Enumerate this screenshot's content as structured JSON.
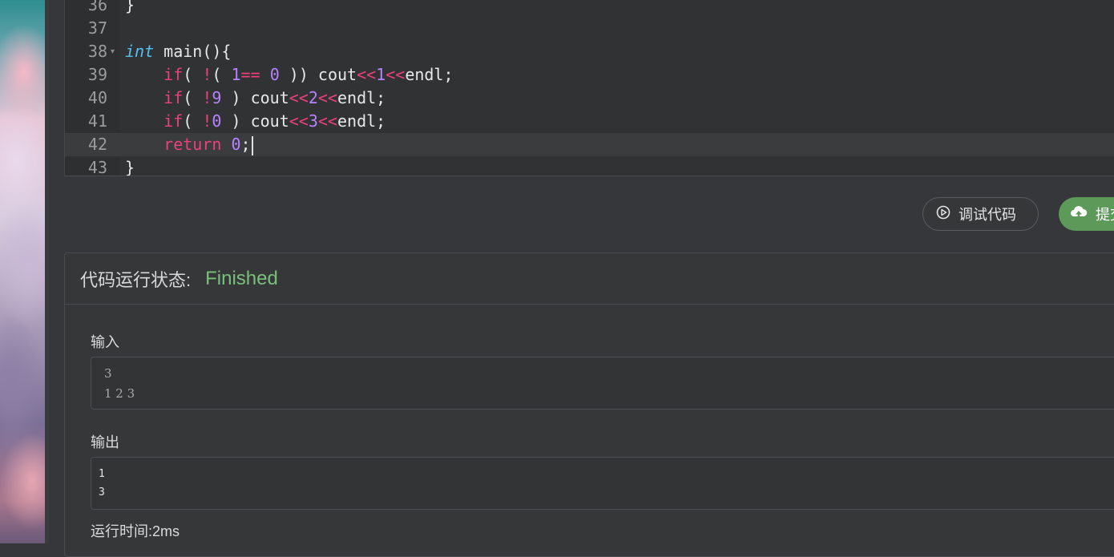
{
  "editor": {
    "lines": [
      {
        "n": "36"
      },
      {
        "n": "37"
      },
      {
        "n": "38"
      },
      {
        "n": "39"
      },
      {
        "n": "40"
      },
      {
        "n": "41"
      },
      {
        "n": "42"
      },
      {
        "n": "43"
      }
    ],
    "code": {
      "l36": "}",
      "l38_type": "int",
      "l38_rest": " main(){",
      "if_kw": "if",
      "cout": "cout",
      "endl": "endl;",
      "shift": "<<",
      "l39_a": "( ",
      "l39_not": "!",
      "l39_b": "( ",
      "l39_one": "1",
      "l39_eq": "==",
      "l39_zero": "0",
      "l39_c": " )) ",
      "l39_val": "1",
      "l40_a": "( ",
      "l40_not": "!",
      "l40_nine": "9",
      "l40_c": " ) ",
      "l40_val": "2",
      "l41_a": "( ",
      "l41_not": "!",
      "l41_zero": "0",
      "l41_c": " ) ",
      "l41_val": "3",
      "return_kw": "return",
      "return_val": "0",
      "semicolon": ";",
      "l43": "}"
    }
  },
  "actions": {
    "debug_label": "调试代码",
    "submit_label": "提交"
  },
  "status": {
    "label": "代码运行状态:",
    "value": "Finished",
    "value_color": "#79c07a"
  },
  "input": {
    "label": "输入",
    "lines": [
      "3",
      "1 2 3"
    ]
  },
  "output": {
    "label": "输出",
    "lines": [
      "1",
      "3"
    ]
  },
  "runtime": "运行时间:2ms",
  "icons": {
    "debug": "play-circle-icon",
    "submit": "cloud-upload-icon"
  }
}
